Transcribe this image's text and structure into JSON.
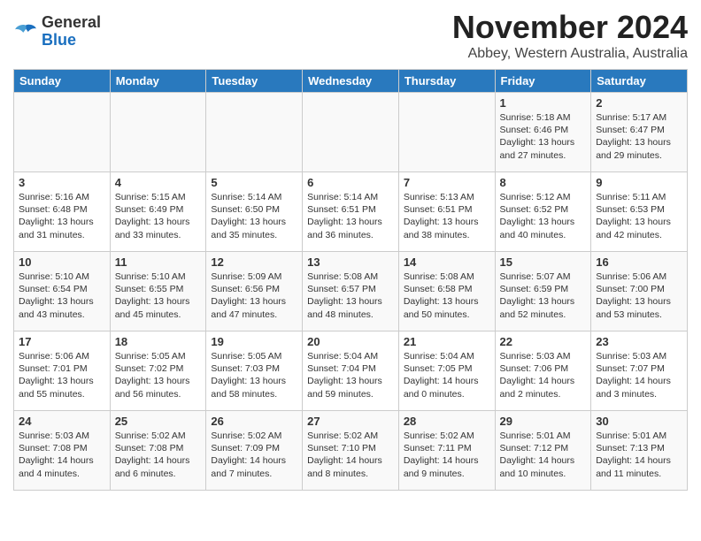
{
  "header": {
    "logo_general": "General",
    "logo_blue": "Blue",
    "title": "November 2024",
    "subtitle": "Abbey, Western Australia, Australia"
  },
  "calendar": {
    "days_of_week": [
      "Sunday",
      "Monday",
      "Tuesday",
      "Wednesday",
      "Thursday",
      "Friday",
      "Saturday"
    ],
    "weeks": [
      [
        {
          "day": "",
          "info": ""
        },
        {
          "day": "",
          "info": ""
        },
        {
          "day": "",
          "info": ""
        },
        {
          "day": "",
          "info": ""
        },
        {
          "day": "",
          "info": ""
        },
        {
          "day": "1",
          "info": "Sunrise: 5:18 AM\nSunset: 6:46 PM\nDaylight: 13 hours\nand 27 minutes."
        },
        {
          "day": "2",
          "info": "Sunrise: 5:17 AM\nSunset: 6:47 PM\nDaylight: 13 hours\nand 29 minutes."
        }
      ],
      [
        {
          "day": "3",
          "info": "Sunrise: 5:16 AM\nSunset: 6:48 PM\nDaylight: 13 hours\nand 31 minutes."
        },
        {
          "day": "4",
          "info": "Sunrise: 5:15 AM\nSunset: 6:49 PM\nDaylight: 13 hours\nand 33 minutes."
        },
        {
          "day": "5",
          "info": "Sunrise: 5:14 AM\nSunset: 6:50 PM\nDaylight: 13 hours\nand 35 minutes."
        },
        {
          "day": "6",
          "info": "Sunrise: 5:14 AM\nSunset: 6:51 PM\nDaylight: 13 hours\nand 36 minutes."
        },
        {
          "day": "7",
          "info": "Sunrise: 5:13 AM\nSunset: 6:51 PM\nDaylight: 13 hours\nand 38 minutes."
        },
        {
          "day": "8",
          "info": "Sunrise: 5:12 AM\nSunset: 6:52 PM\nDaylight: 13 hours\nand 40 minutes."
        },
        {
          "day": "9",
          "info": "Sunrise: 5:11 AM\nSunset: 6:53 PM\nDaylight: 13 hours\nand 42 minutes."
        }
      ],
      [
        {
          "day": "10",
          "info": "Sunrise: 5:10 AM\nSunset: 6:54 PM\nDaylight: 13 hours\nand 43 minutes."
        },
        {
          "day": "11",
          "info": "Sunrise: 5:10 AM\nSunset: 6:55 PM\nDaylight: 13 hours\nand 45 minutes."
        },
        {
          "day": "12",
          "info": "Sunrise: 5:09 AM\nSunset: 6:56 PM\nDaylight: 13 hours\nand 47 minutes."
        },
        {
          "day": "13",
          "info": "Sunrise: 5:08 AM\nSunset: 6:57 PM\nDaylight: 13 hours\nand 48 minutes."
        },
        {
          "day": "14",
          "info": "Sunrise: 5:08 AM\nSunset: 6:58 PM\nDaylight: 13 hours\nand 50 minutes."
        },
        {
          "day": "15",
          "info": "Sunrise: 5:07 AM\nSunset: 6:59 PM\nDaylight: 13 hours\nand 52 minutes."
        },
        {
          "day": "16",
          "info": "Sunrise: 5:06 AM\nSunset: 7:00 PM\nDaylight: 13 hours\nand 53 minutes."
        }
      ],
      [
        {
          "day": "17",
          "info": "Sunrise: 5:06 AM\nSunset: 7:01 PM\nDaylight: 13 hours\nand 55 minutes."
        },
        {
          "day": "18",
          "info": "Sunrise: 5:05 AM\nSunset: 7:02 PM\nDaylight: 13 hours\nand 56 minutes."
        },
        {
          "day": "19",
          "info": "Sunrise: 5:05 AM\nSunset: 7:03 PM\nDaylight: 13 hours\nand 58 minutes."
        },
        {
          "day": "20",
          "info": "Sunrise: 5:04 AM\nSunset: 7:04 PM\nDaylight: 13 hours\nand 59 minutes."
        },
        {
          "day": "21",
          "info": "Sunrise: 5:04 AM\nSunset: 7:05 PM\nDaylight: 14 hours\nand 0 minutes."
        },
        {
          "day": "22",
          "info": "Sunrise: 5:03 AM\nSunset: 7:06 PM\nDaylight: 14 hours\nand 2 minutes."
        },
        {
          "day": "23",
          "info": "Sunrise: 5:03 AM\nSunset: 7:07 PM\nDaylight: 14 hours\nand 3 minutes."
        }
      ],
      [
        {
          "day": "24",
          "info": "Sunrise: 5:03 AM\nSunset: 7:08 PM\nDaylight: 14 hours\nand 4 minutes."
        },
        {
          "day": "25",
          "info": "Sunrise: 5:02 AM\nSunset: 7:08 PM\nDaylight: 14 hours\nand 6 minutes."
        },
        {
          "day": "26",
          "info": "Sunrise: 5:02 AM\nSunset: 7:09 PM\nDaylight: 14 hours\nand 7 minutes."
        },
        {
          "day": "27",
          "info": "Sunrise: 5:02 AM\nSunset: 7:10 PM\nDaylight: 14 hours\nand 8 minutes."
        },
        {
          "day": "28",
          "info": "Sunrise: 5:02 AM\nSunset: 7:11 PM\nDaylight: 14 hours\nand 9 minutes."
        },
        {
          "day": "29",
          "info": "Sunrise: 5:01 AM\nSunset: 7:12 PM\nDaylight: 14 hours\nand 10 minutes."
        },
        {
          "day": "30",
          "info": "Sunrise: 5:01 AM\nSunset: 7:13 PM\nDaylight: 14 hours\nand 11 minutes."
        }
      ]
    ]
  }
}
